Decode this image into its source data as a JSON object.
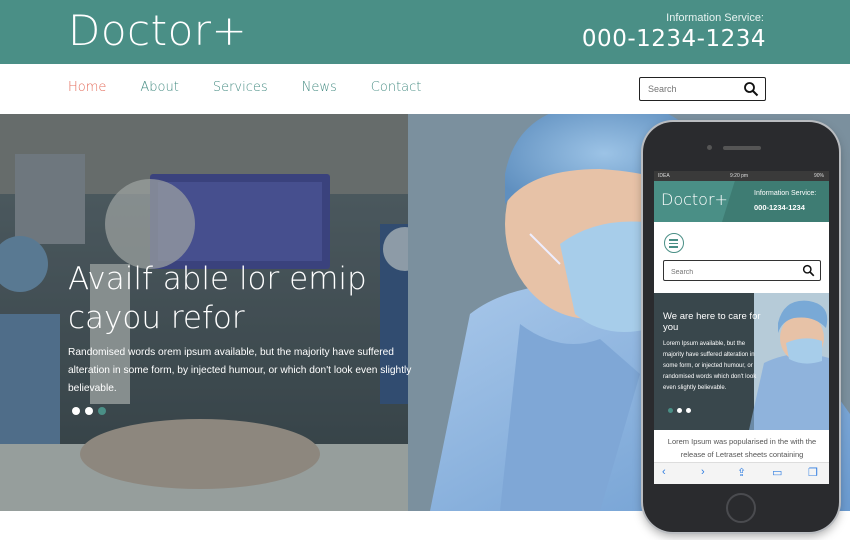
{
  "header": {
    "logo": "Doctor+",
    "info_label": "Information Service:",
    "phone": "000-1234-1234"
  },
  "nav": {
    "items": [
      {
        "label": "Home",
        "active": true
      },
      {
        "label": "About",
        "active": false
      },
      {
        "label": "Services",
        "active": false
      },
      {
        "label": "News",
        "active": false
      },
      {
        "label": "Contact",
        "active": false
      }
    ],
    "search_placeholder": "Search"
  },
  "hero": {
    "title": "Availf able lor emip cayou refor",
    "text": "Randomised words orem ipsum available, but the majority have suffered alteration in some form, by injected humour, or which don't look even slightly believable.",
    "slides_total": 3,
    "active_slide": 3
  },
  "mobile": {
    "status_carrier": "IDEA",
    "status_time": "9:20 pm",
    "status_battery": "90%",
    "logo": "Doctor+",
    "info_label": "Information Service:",
    "phone": "000-1234-1234",
    "search_placeholder": "Search",
    "hero_title": "We are here to care for you",
    "hero_text": "Lorem Ipsum available, but the majority have suffered alteration in some form, or injected humour, or randomised words which don't look even slightly believable.",
    "body_text": "Lorem Ipsum was popularised in the with the release of Letraset sheets containing"
  },
  "colors": {
    "brand": "#4a8f86",
    "active_nav": "#e46b5a",
    "ios_blue": "#2f7de1"
  }
}
